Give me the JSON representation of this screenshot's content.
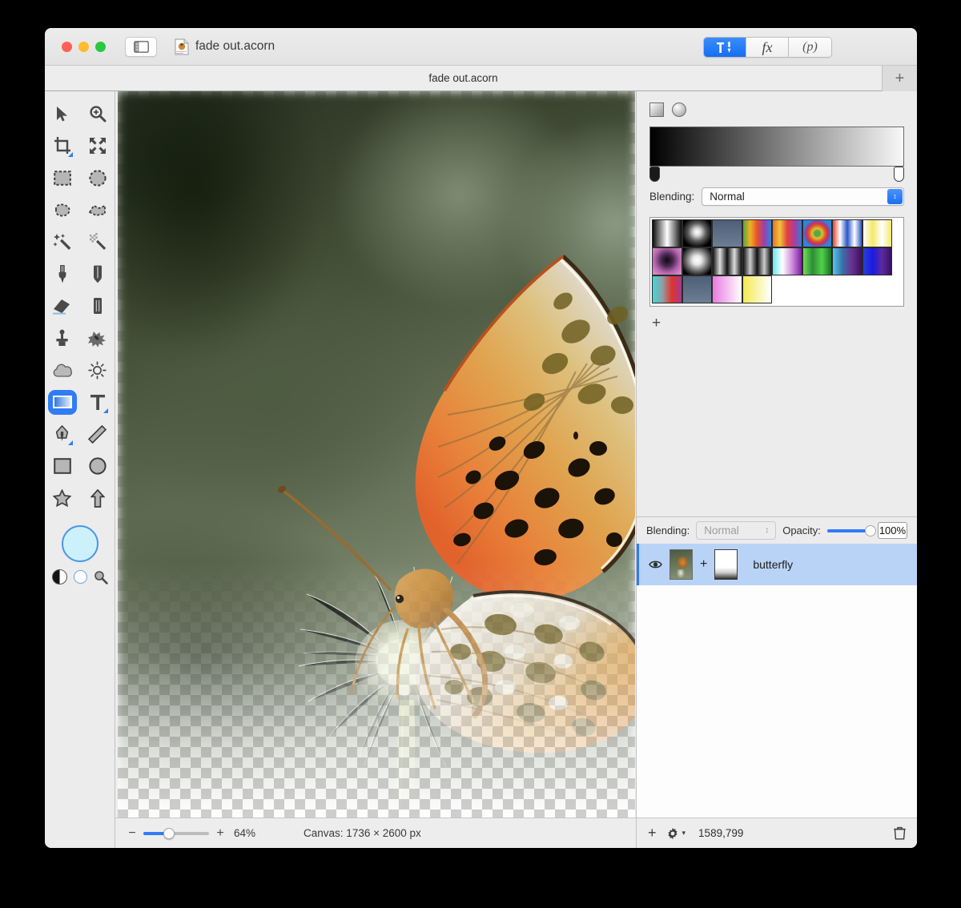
{
  "window": {
    "title": "fade out.acorn",
    "traffic_lights": [
      "close",
      "minimize",
      "zoom"
    ],
    "sidebar_toggle_icon": "sidebar-icon",
    "document_icon": "acorn-document-icon"
  },
  "toolbar": {
    "segments": [
      {
        "label": "",
        "icon": "tools-hammer-brush-icon",
        "active": true
      },
      {
        "label": "fx",
        "icon": "effects-icon",
        "active": false
      },
      {
        "label": "(p)",
        "icon": "palette-icon",
        "active": false
      }
    ],
    "accent_color": "#2f7cf6"
  },
  "tabbar": {
    "tab_title": "fade out.acorn",
    "add_tab_label": "+"
  },
  "tools": {
    "items": [
      {
        "name": "move-tool",
        "glyph": "➤",
        "selected": false
      },
      {
        "name": "zoom-tool",
        "glyph": "🔍",
        "selected": false
      },
      {
        "name": "crop-tool",
        "glyph": "✇",
        "selected": false
      },
      {
        "name": "transform-tool",
        "glyph": "✢",
        "selected": false
      },
      {
        "name": "rectangle-select-tool",
        "glyph": "⬚",
        "selected": false
      },
      {
        "name": "ellipse-select-tool",
        "glyph": "○",
        "selected": false
      },
      {
        "name": "lasso-select-tool",
        "glyph": "☁",
        "selected": false
      },
      {
        "name": "polygon-lasso-tool",
        "glyph": "▱",
        "selected": false
      },
      {
        "name": "magic-wand-tool",
        "glyph": "✨",
        "selected": false
      },
      {
        "name": "select-similar-tool",
        "glyph": "✳",
        "selected": false
      },
      {
        "name": "paintbrush-tool",
        "glyph": "▼",
        "selected": false
      },
      {
        "name": "pencil-tool",
        "glyph": "✏",
        "selected": false
      },
      {
        "name": "eraser-tool",
        "glyph": "◢",
        "selected": false
      },
      {
        "name": "marker-tool",
        "glyph": "❙",
        "selected": false
      },
      {
        "name": "clone-stamp-tool",
        "glyph": "☗",
        "selected": false
      },
      {
        "name": "smudge-tool",
        "glyph": "⁂",
        "selected": false
      },
      {
        "name": "blur-tool",
        "glyph": "☁",
        "selected": false
      },
      {
        "name": "dodge-burn-tool",
        "glyph": "☀",
        "selected": false
      },
      {
        "name": "gradient-tool",
        "glyph": "▬",
        "selected": true
      },
      {
        "name": "text-tool",
        "glyph": "T",
        "selected": false
      },
      {
        "name": "bezier-pen-tool",
        "glyph": "✒",
        "selected": false
      },
      {
        "name": "line-tool",
        "glyph": "╱",
        "selected": false
      },
      {
        "name": "rectangle-shape-tool",
        "glyph": "□",
        "selected": false
      },
      {
        "name": "ellipse-shape-tool",
        "glyph": "●",
        "selected": false
      },
      {
        "name": "star-shape-tool",
        "glyph": "☆",
        "selected": false
      },
      {
        "name": "arrow-shape-tool",
        "glyph": "⇧",
        "selected": false
      }
    ],
    "foreground_color": "#cdf1fb",
    "swatch_extras": [
      "invert-colors-icon",
      "white-color-icon",
      "color-picker-icon"
    ]
  },
  "gradient_panel": {
    "type_buttons": [
      {
        "name": "linear-gradient-type",
        "selected": true
      },
      {
        "name": "radial-gradient-type",
        "selected": false
      }
    ],
    "gradient_start_color": "#000000",
    "gradient_end_color": "#f8f8f8",
    "blending_label": "Blending:",
    "blending_value": "Normal",
    "add_preset_label": "+",
    "presets": [
      [
        "linear-gradient(90deg,#0b0b0b,#ffffff,#0b0b0b)",
        "radial-gradient(circle at 50% 45%,#ffffff 0%,#d8d8d8 18%,#5a5a5a 45%,#000000 78%)",
        "linear-gradient(180deg,#4d5f77,#6d7e93)",
        "linear-gradient(90deg,#5ba33f,#f0b224,#e8502c,#9b3fae,#2f86d4)",
        "linear-gradient(90deg,#e8742a,#f0c33a,#e3413f,#b03a9e,#2d7fd0)",
        "radial-gradient(circle at 50% 50%,#5aa54a 0%,#5aa54a 14%,#e2c12e 26%,#e0732a 38%,#cf3f3c 50%,#a2399c 62%,#2f86d4 72%)",
        "linear-gradient(90deg,#e0453c,#ffffff,#2b55c8,#ffffff,#2b55c8)",
        "linear-gradient(90deg,#ffffff,#f3e96b,#ffffff,#f3e96b)"
      ],
      [
        "radial-gradient(circle at 50% 45%,#140714 0%,#4a2a52 30%,#b866b0 62%,#d28fc0 90%)",
        "radial-gradient(circle at 50% 45%,#ffffff 0%,#e8e8e8 22%,#6a6a6a 55%,#000000 85%)",
        "linear-gradient(90deg,#111,#ddd,#111,#ddd,#111)",
        "linear-gradient(90deg,#111,#ccc,#111,#ccc,#111)",
        "linear-gradient(90deg,#64e6ef,#ffffff,#cf8ede,#7a1f9e)",
        "linear-gradient(90deg,#6fe05a,#2e8c35,#4fd347,#1e6b2a)",
        "linear-gradient(90deg,#4fc9e8,#3b6fa8,#6a2f8e,#3b1060)",
        "linear-gradient(90deg,#2b3fd8,#1a1ae0,#5a2b9e,#3a1060)"
      ],
      [
        "linear-gradient(90deg,#3fd9d4,#8f9fa8,#e0342a,#a13b96)",
        "linear-gradient(180deg,#4d5f77,#6d7e93)",
        "linear-gradient(90deg,#e97ae0,#ffffff)",
        "linear-gradient(90deg,#f3eb52,#ffffff)"
      ]
    ]
  },
  "layers_panel": {
    "blending_label": "Blending:",
    "blending_value": "Normal",
    "opacity_label": "Opacity:",
    "opacity_value": "100%",
    "layers": [
      {
        "name": "butterfly",
        "visible": true,
        "selected": true,
        "has_mask": true,
        "mask_separator": "+"
      }
    ],
    "footer": {
      "add_layer_label": "+",
      "settings_icon": "gear-icon",
      "coordinates": "1589,799",
      "delete_icon": "trash-icon"
    }
  },
  "statusbar": {
    "zoom_out_label": "−",
    "zoom_in_label": "+",
    "zoom_value": "64%",
    "canvas_size": "Canvas: 1736 × 2600 px"
  }
}
